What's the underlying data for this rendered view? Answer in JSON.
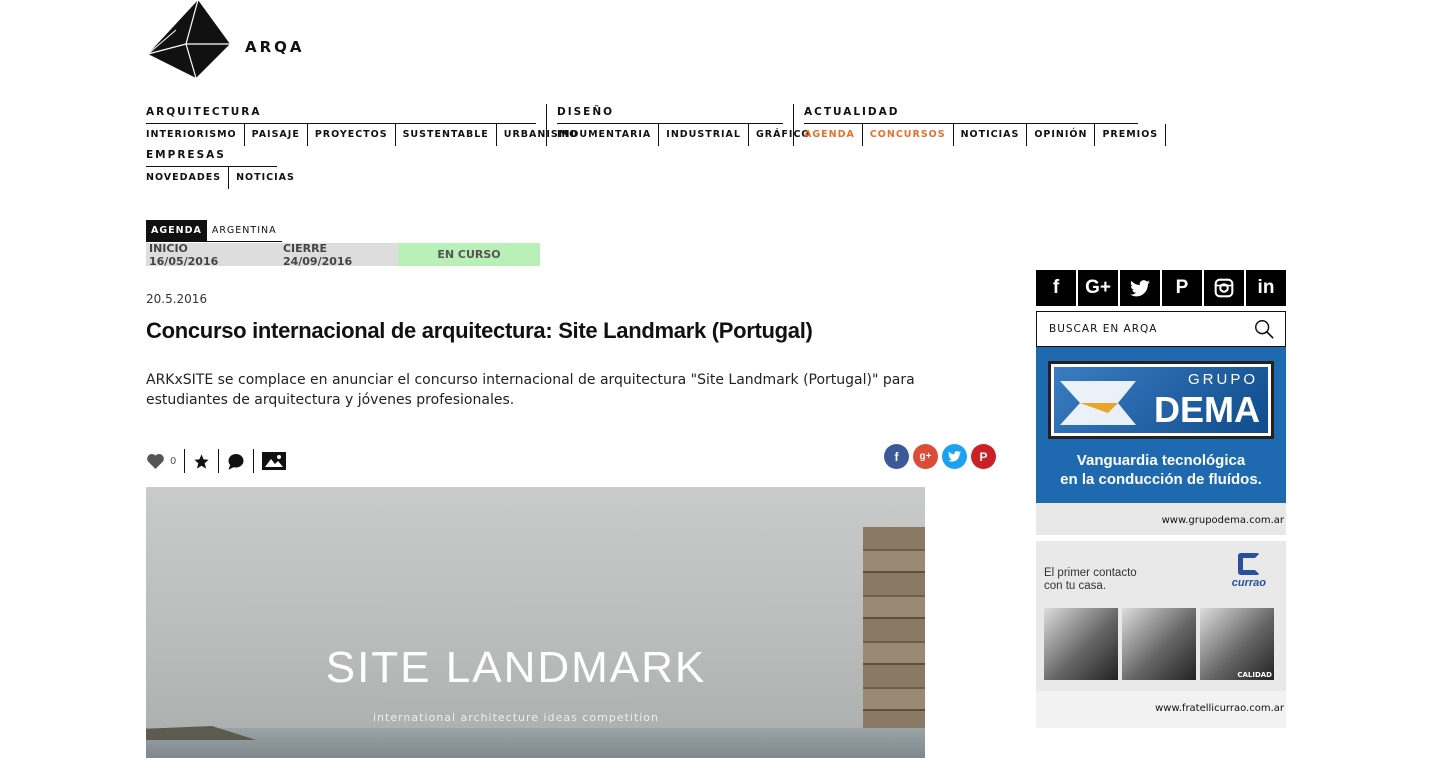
{
  "brand": {
    "name": "ARQA"
  },
  "nav": {
    "arquitectura": {
      "heading": "ARQUITECTURA",
      "items": [
        "INTERIORISMO",
        "PAISAJE",
        "PROYECTOS",
        "SUSTENTABLE",
        "URBANISMO"
      ]
    },
    "diseno": {
      "heading": "DISEÑO",
      "items": [
        "INDUMENTARIA",
        "INDUSTRIAL",
        "GRÁFICO"
      ]
    },
    "actualidad": {
      "heading": "ACTUALIDAD",
      "items": [
        "AGENDA",
        "CONCURSOS",
        "NOTICIAS",
        "OPINIÓN",
        "PREMIOS"
      ],
      "active": [
        "AGENDA",
        "CONCURSOS"
      ]
    },
    "empresas": {
      "heading": "EMPRESAS",
      "items": [
        "NOVEDADES",
        "NOTICIAS"
      ]
    }
  },
  "colors": {
    "accent": "#e8702a",
    "status_green": "#b8f0b8",
    "facebook": "#3b5998",
    "gplus": "#dd4b39",
    "twitter": "#1da1f2",
    "pinterest": "#cb2027"
  },
  "article": {
    "tag_primary": "AGENDA",
    "tag_secondary": "ARGENTINA",
    "start": "INICIO 16/05/2016",
    "end": "CIERRE 24/09/2016",
    "status": "EN CURSO",
    "date": "20.5.2016",
    "title": "Concurso internacional de arquitectura: Site Landmark (Portugal)",
    "lead": "ARKxSITE se complace en anunciar el concurso internacional de arquitectura \"Site Landmark (Portugal)\" para estudiantes de arquitectura y jóvenes profesionales.",
    "likes": "0",
    "actions": [
      "heart-icon",
      "star-icon",
      "comment-icon",
      "gallery-icon"
    ],
    "share": [
      "facebook-icon",
      "google-plus-icon",
      "twitter-icon",
      "pinterest-icon"
    ],
    "hero": {
      "title": "SITE LANDMARK",
      "subtitle": "international architecture ideas competition"
    }
  },
  "sidebar": {
    "social": [
      {
        "label": "f",
        "icon": "facebook-icon"
      },
      {
        "label": "G+",
        "icon": "google-plus-icon"
      },
      {
        "label": "t",
        "icon": "twitter-icon"
      },
      {
        "label": "P",
        "icon": "pinterest-icon"
      },
      {
        "label": "◎",
        "icon": "instagram-icon"
      },
      {
        "label": "in",
        "icon": "linkedin-icon"
      }
    ],
    "search_placeholder": "BUSCAR EN ARQA",
    "ad1": {
      "group": "GRUPO",
      "name": "DEMA",
      "tagline_1": "Vanguardia tecnológica",
      "tagline_2": "en la conducción de fluídos.",
      "url": "www.grupodema.com.ar"
    },
    "ad2": {
      "text_1": "El primer contacto",
      "text_2": "con tu casa.",
      "brand": "currao",
      "badge": "CALIDAD",
      "url": "www.fratellicurrao.com.ar"
    }
  }
}
